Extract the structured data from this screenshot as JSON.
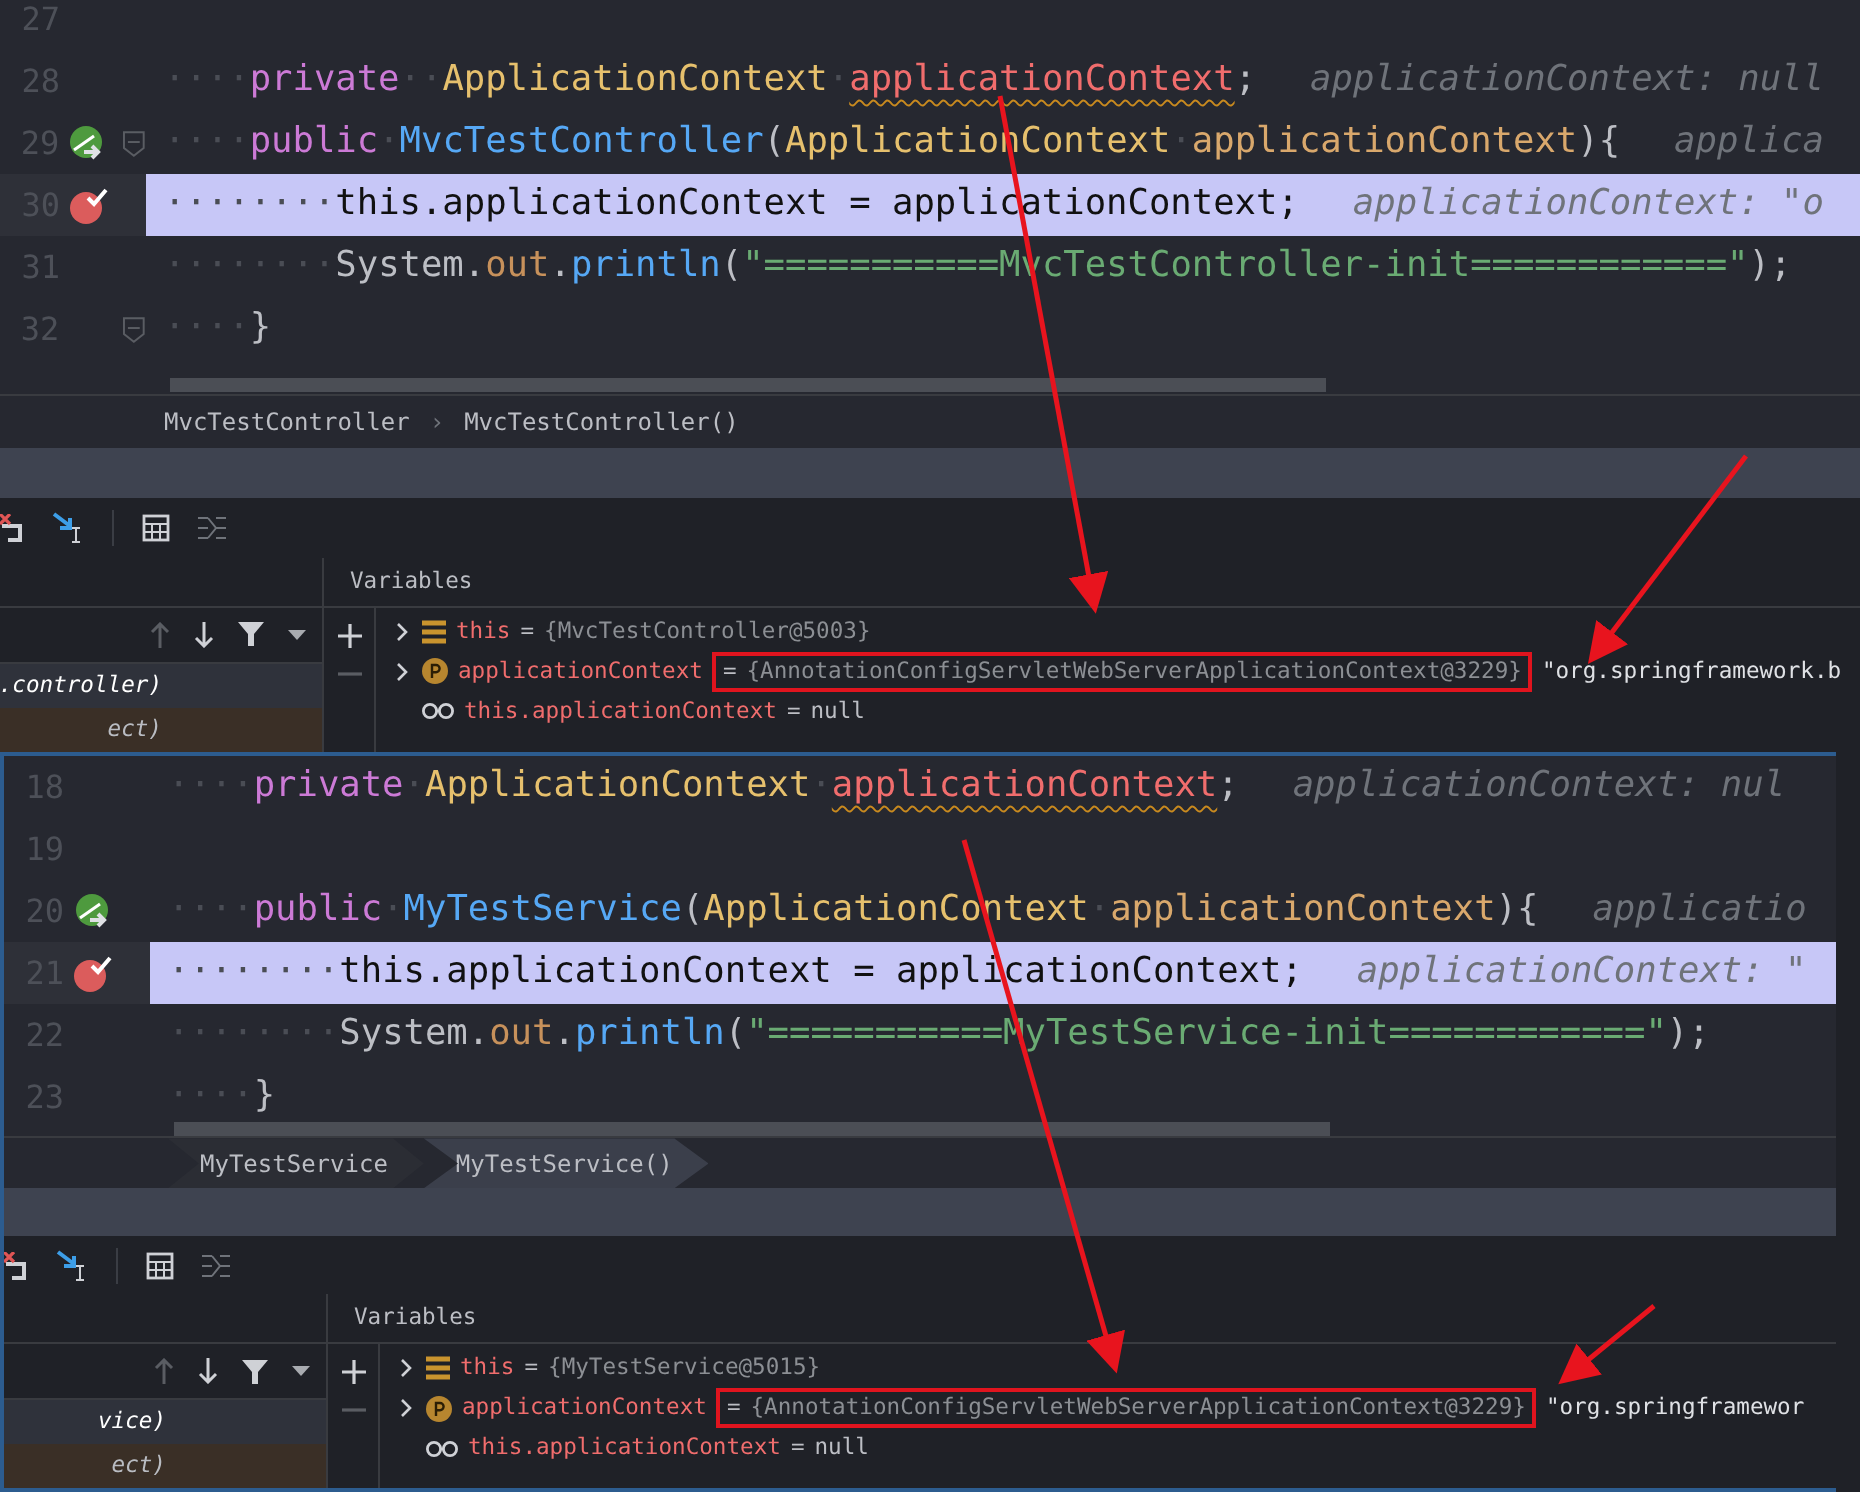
{
  "panels": [
    {
      "code_lines": [
        {
          "number": "27",
          "highlighted": false
        },
        {
          "number": "28",
          "highlighted": false,
          "tokens": [
            {
              "kind": "indent",
              "text": "····"
            },
            {
              "kind": "keyword",
              "text": "private"
            },
            {
              "kind": "indent",
              "text": "··"
            },
            {
              "kind": "type",
              "text": "ApplicationContext"
            },
            {
              "kind": "indent",
              "text": "·"
            },
            {
              "kind": "field",
              "text": "applicationContext"
            },
            {
              "kind": "plain",
              "text": ";"
            }
          ],
          "hint": "applicationContext: null"
        },
        {
          "number": "29",
          "highlighted": false,
          "gutter_icon": {
            "kind": "step"
          },
          "fold": true,
          "tokens": [
            {
              "kind": "indent",
              "text": "····"
            },
            {
              "kind": "keyword",
              "text": "public"
            },
            {
              "kind": "indent",
              "text": "·"
            },
            {
              "kind": "method",
              "text": "MvcTestController"
            },
            {
              "kind": "plain",
              "text": "("
            },
            {
              "kind": "type",
              "text": "ApplicationContext"
            },
            {
              "kind": "indent",
              "text": "·"
            },
            {
              "kind": "param",
              "text": "applicationContext"
            },
            {
              "kind": "plain",
              "text": "){"
            }
          ],
          "hint": "applica"
        },
        {
          "number": "30",
          "highlighted": true,
          "gutter_icon": {
            "kind": "breakpoint"
          },
          "tokens": [
            {
              "kind": "indent",
              "text": "········"
            },
            {
              "kind": "plain",
              "text": "this.applicationContext = applicationContext;"
            }
          ],
          "hint": "applicationContext: \"o"
        },
        {
          "number": "31",
          "highlighted": false,
          "tokens": [
            {
              "kind": "indent",
              "text": "········"
            },
            {
              "kind": "plain",
              "text": "System."
            },
            {
              "kind": "static",
              "text": "out"
            },
            {
              "kind": "plain",
              "text": "."
            },
            {
              "kind": "method",
              "text": "println"
            },
            {
              "kind": "plain",
              "text": "("
            },
            {
              "kind": "string",
              "text": "\"===========MvcTestController-init============\""
            },
            {
              "kind": "plain",
              "text": ");"
            }
          ]
        },
        {
          "number": "32",
          "highlighted": false,
          "fold": true,
          "tokens": [
            {
              "kind": "indent",
              "text": "····"
            },
            {
              "kind": "plain",
              "text": "}"
            }
          ]
        }
      ],
      "breadcrumbs": {
        "kind": "plain",
        "separator": "›",
        "items": [
          {
            "label": "MvcTestController",
            "selected": false
          },
          {
            "label": "MvcTestController()",
            "selected": false
          }
        ]
      },
      "frames": [
        {
          "text": ".controller)",
          "selected": true,
          "library": false
        },
        {
          "text": "ect)",
          "selected": false,
          "library": true
        }
      ],
      "variables_title": "Variables",
      "variables": [
        {
          "kind": "object",
          "name": "this",
          "equals": "=",
          "value": "{MvcTestController@5003}",
          "expandable": true
        },
        {
          "kind": "param",
          "name": "applicationContext",
          "equals": "=",
          "value": "{AnnotationConfigServletWebServerApplicationContext@3229}",
          "extra": "\"org.springframework.b",
          "expandable": true,
          "marked": true
        },
        {
          "kind": "watch",
          "name": "this.applicationContext",
          "equals": "=",
          "value": "null",
          "expandable": false
        }
      ]
    },
    {
      "code_lines": [
        {
          "number": "18",
          "highlighted": false,
          "tokens": [
            {
              "kind": "indent",
              "text": "····"
            },
            {
              "kind": "keyword",
              "text": "private"
            },
            {
              "kind": "indent",
              "text": "·"
            },
            {
              "kind": "type",
              "text": "ApplicationContext"
            },
            {
              "kind": "indent",
              "text": "·"
            },
            {
              "kind": "field",
              "text": "applicationContext"
            },
            {
              "kind": "plain",
              "text": ";"
            }
          ],
          "hint": "applicationContext: nul"
        },
        {
          "number": "19",
          "highlighted": false
        },
        {
          "number": "20",
          "highlighted": false,
          "gutter_icon": {
            "kind": "step"
          },
          "tokens": [
            {
              "kind": "indent",
              "text": "····"
            },
            {
              "kind": "keyword",
              "text": "public"
            },
            {
              "kind": "indent",
              "text": "·"
            },
            {
              "kind": "method",
              "text": "MyTestService"
            },
            {
              "kind": "plain",
              "text": "("
            },
            {
              "kind": "type",
              "text": "ApplicationContext"
            },
            {
              "kind": "indent",
              "text": "·"
            },
            {
              "kind": "param",
              "text": "applicationContext"
            },
            {
              "kind": "plain",
              "text": "){"
            }
          ],
          "hint": "applicatio"
        },
        {
          "number": "21",
          "highlighted": true,
          "gutter_icon": {
            "kind": "breakpoint"
          },
          "tokens": [
            {
              "kind": "indent",
              "text": "········"
            },
            {
              "kind": "plain",
              "text": "this.applicationContext = applicationContext;"
            }
          ],
          "hint": "applicationContext: \""
        },
        {
          "number": "22",
          "highlighted": false,
          "tokens": [
            {
              "kind": "indent",
              "text": "········"
            },
            {
              "kind": "plain",
              "text": "System."
            },
            {
              "kind": "static",
              "text": "out"
            },
            {
              "kind": "plain",
              "text": "."
            },
            {
              "kind": "method",
              "text": "println"
            },
            {
              "kind": "plain",
              "text": "("
            },
            {
              "kind": "string",
              "text": "\"===========MyTestService-init============\""
            },
            {
              "kind": "plain",
              "text": ");"
            }
          ]
        },
        {
          "number": "23",
          "highlighted": false,
          "tokens": [
            {
              "kind": "indent",
              "text": "····"
            },
            {
              "kind": "plain",
              "text": "}"
            }
          ]
        }
      ],
      "breadcrumbs": {
        "kind": "chevron",
        "items": [
          {
            "label": "MyTestService",
            "selected": false
          },
          {
            "label": "MyTestService()",
            "selected": true
          }
        ]
      },
      "frames": [
        {
          "text": "vice)",
          "selected": true,
          "library": false
        },
        {
          "text": "ect)",
          "selected": false,
          "library": true
        }
      ],
      "variables_title": "Variables",
      "variables": [
        {
          "kind": "object",
          "name": "this",
          "equals": "=",
          "value": "{MyTestService@5015}",
          "expandable": true
        },
        {
          "kind": "param",
          "name": "applicationContext",
          "equals": "=",
          "value": "{AnnotationConfigServletWebServerApplicationContext@3229}",
          "extra": "\"org.springframewor",
          "expandable": true,
          "marked": true
        },
        {
          "kind": "watch",
          "name": "this.applicationContext",
          "equals": "=",
          "value": "null",
          "expandable": false
        }
      ]
    }
  ]
}
